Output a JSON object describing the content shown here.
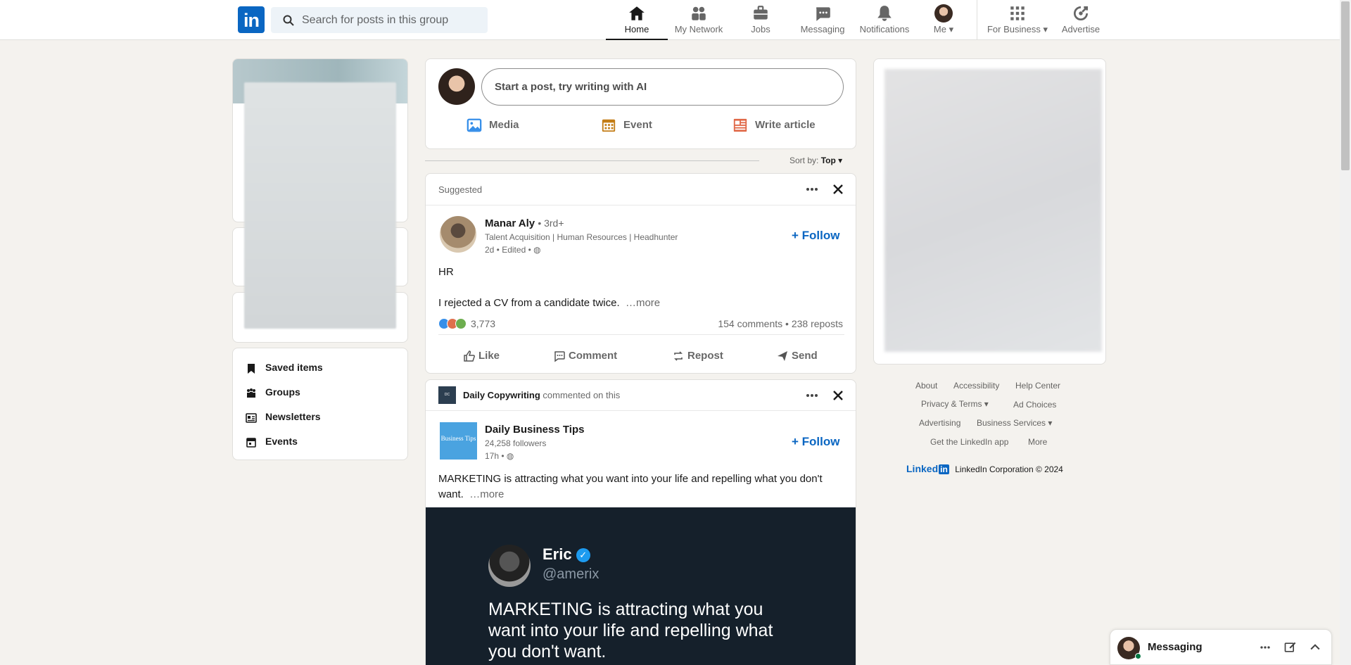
{
  "nav": {
    "logo": "in",
    "search_placeholder": "Search for posts in this group",
    "items": [
      {
        "label": "Home",
        "icon": "home-icon"
      },
      {
        "label": "My Network",
        "icon": "network-icon"
      },
      {
        "label": "Jobs",
        "icon": "briefcase-icon"
      },
      {
        "label": "Messaging",
        "icon": "messaging-icon"
      },
      {
        "label": "Notifications",
        "icon": "bell-icon"
      },
      {
        "label": "Me",
        "icon": "avatar"
      },
      {
        "label": "For Business",
        "icon": "grid-icon"
      },
      {
        "label": "Advertise",
        "icon": "advertise-icon"
      }
    ]
  },
  "left": {
    "links": [
      {
        "label": "Saved items",
        "icon": "bookmark-icon"
      },
      {
        "label": "Groups",
        "icon": "groups-icon"
      },
      {
        "label": "Newsletters",
        "icon": "newsletter-icon"
      },
      {
        "label": "Events",
        "icon": "calendar-icon"
      }
    ]
  },
  "composer": {
    "placeholder": "Start a post, try writing with AI",
    "actions": [
      {
        "label": "Media",
        "icon": "image-icon",
        "color": "#378fe9"
      },
      {
        "label": "Event",
        "icon": "calendar-icon",
        "color": "#c37d16"
      },
      {
        "label": "Write article",
        "icon": "article-icon",
        "color": "#e06847"
      }
    ]
  },
  "sort": {
    "prefix": "Sort by:",
    "value": "Top"
  },
  "post1": {
    "header": "Suggested",
    "author": "Manar Aly",
    "degree": "• 3rd+",
    "headline": "Talent Acquisition | Human Resources | Headhunter",
    "meta": "2d • Edited •",
    "follow": "+ Follow",
    "text_line1": "HR",
    "text_line2": "I rejected a CV from a candidate twice.",
    "more": "…more",
    "reactions": "3,773",
    "stats": "154 comments • 238 reposts",
    "actions": [
      "Like",
      "Comment",
      "Repost",
      "Send"
    ]
  },
  "post2": {
    "actor": "Daily Copywriting",
    "actor_action": "commented on this",
    "author": "Daily Business Tips",
    "author_logo": "Business Tips",
    "followers": "24,258 followers",
    "meta": "17h •",
    "follow": "+ Follow",
    "text": "MARKETING is attracting what you want into your life and repelling what you don't want.",
    "more": "…more",
    "image": {
      "name": "Eric",
      "handle": "@amerix",
      "quote": "MARKETING is attracting what you want into your life and repelling what you don't want."
    }
  },
  "footer": {
    "links": [
      "About",
      "Accessibility",
      "Help Center",
      "Privacy & Terms",
      "Ad Choices",
      "Advertising",
      "Business Services",
      "Get the LinkedIn app",
      "More"
    ],
    "brand": "Linked",
    "brand_in": "in",
    "copyright": "LinkedIn Corporation © 2024"
  },
  "messaging": {
    "label": "Messaging"
  },
  "colors": {
    "accent": "#0a66c2",
    "bg": "#f4f2ee"
  }
}
